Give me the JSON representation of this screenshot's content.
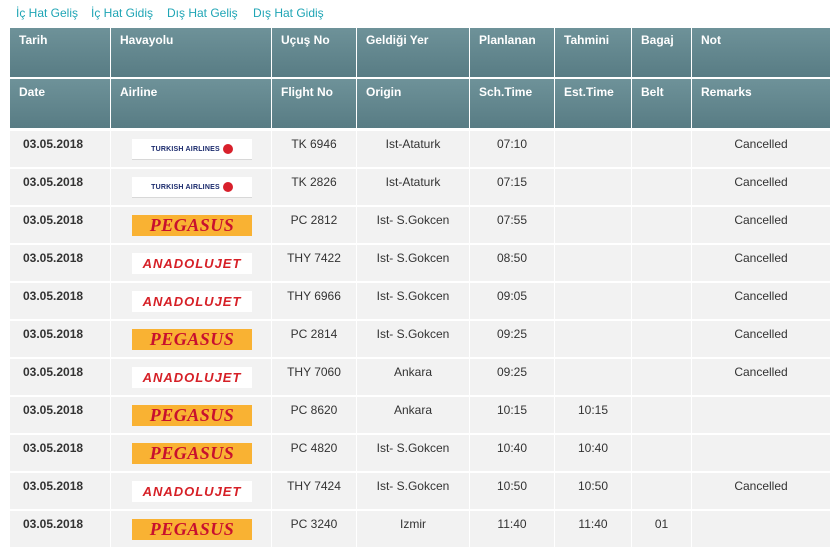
{
  "tabs": [
    "İç Hat Geliş",
    "İç Hat Gidiş",
    "Dış Hat Geliş",
    "Dış Hat Gidiş"
  ],
  "headers_tr": [
    "Tarih",
    "Havayolu",
    "Uçuş No",
    "Geldiği Yer",
    "Planlanan",
    "Tahmini",
    "Bagaj",
    "Not"
  ],
  "headers_en": [
    "Date",
    "Airline",
    "Flight No",
    "Origin",
    "Sch.Time",
    "Est.Time",
    "Belt",
    "Remarks"
  ],
  "logos": {
    "turkish": "TURKISH AIRLINES",
    "pegasus": "PEGASUS",
    "anadolu": "ANADOLUJET"
  },
  "colors": {
    "header_bg": "#658a91",
    "row_bg": "#f2f2f2",
    "tab_link": "#1fa5b5",
    "pegasus_bg": "#f9b233",
    "pegasus_text": "#c8102e",
    "anadolu_text": "#d62027",
    "turkish_text": "#1a2a6c"
  },
  "flights": [
    {
      "date": "03.05.2018",
      "airline": "turkish",
      "flight": "TK  6946",
      "origin": "Ist-Ataturk",
      "sch": "07:10",
      "est": "",
      "belt": "",
      "remarks": "Cancelled"
    },
    {
      "date": "03.05.2018",
      "airline": "turkish",
      "flight": "TK  2826",
      "origin": "Ist-Ataturk",
      "sch": "07:15",
      "est": "",
      "belt": "",
      "remarks": "Cancelled"
    },
    {
      "date": "03.05.2018",
      "airline": "pegasus",
      "flight": "PC  2812",
      "origin": "Ist- S.Gokcen",
      "sch": "07:55",
      "est": "",
      "belt": "",
      "remarks": "Cancelled"
    },
    {
      "date": "03.05.2018",
      "airline": "anadolu",
      "flight": "THY 7422",
      "origin": "Ist- S.Gokcen",
      "sch": "08:50",
      "est": "",
      "belt": "",
      "remarks": "Cancelled"
    },
    {
      "date": "03.05.2018",
      "airline": "anadolu",
      "flight": "THY 6966",
      "origin": "Ist- S.Gokcen",
      "sch": "09:05",
      "est": "",
      "belt": "",
      "remarks": "Cancelled"
    },
    {
      "date": "03.05.2018",
      "airline": "pegasus",
      "flight": "PC  2814",
      "origin": "Ist- S.Gokcen",
      "sch": "09:25",
      "est": "",
      "belt": "",
      "remarks": "Cancelled"
    },
    {
      "date": "03.05.2018",
      "airline": "anadolu",
      "flight": "THY 7060",
      "origin": "Ankara",
      "sch": "09:25",
      "est": "",
      "belt": "",
      "remarks": "Cancelled"
    },
    {
      "date": "03.05.2018",
      "airline": "pegasus",
      "flight": "PC  8620",
      "origin": "Ankara",
      "sch": "10:15",
      "est": "10:15",
      "belt": "",
      "remarks": ""
    },
    {
      "date": "03.05.2018",
      "airline": "pegasus",
      "flight": "PC  4820",
      "origin": "Ist- S.Gokcen",
      "sch": "10:40",
      "est": "10:40",
      "belt": "",
      "remarks": ""
    },
    {
      "date": "03.05.2018",
      "airline": "anadolu",
      "flight": "THY 7424",
      "origin": "Ist- S.Gokcen",
      "sch": "10:50",
      "est": "10:50",
      "belt": "",
      "remarks": "Cancelled"
    },
    {
      "date": "03.05.2018",
      "airline": "pegasus",
      "flight": "PC  3240",
      "origin": "Izmir",
      "sch": "11:40",
      "est": "11:40",
      "belt": "01",
      "remarks": ""
    }
  ]
}
